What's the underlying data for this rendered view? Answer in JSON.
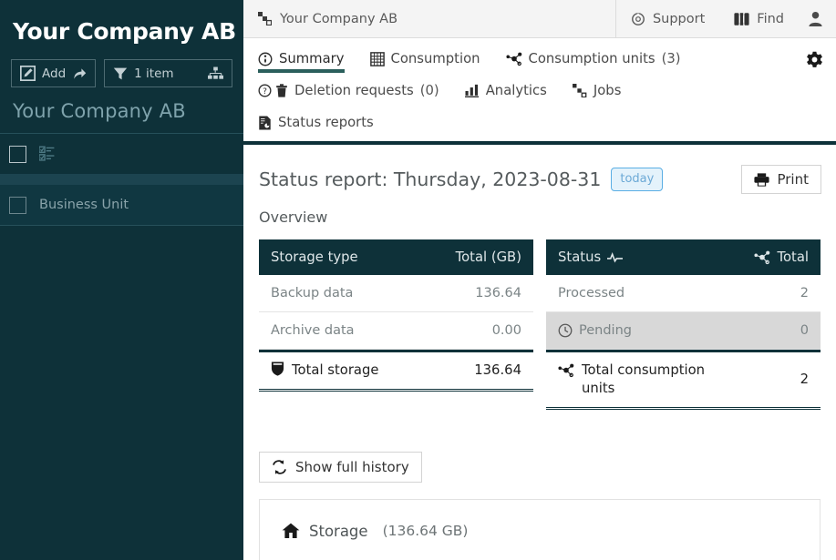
{
  "sidebar": {
    "logo": "Your Company AB",
    "add_label": "Add",
    "filter_label": "1 item",
    "title": "Your Company AB",
    "rows": [
      {
        "label": ""
      },
      {
        "label": "Business Unit"
      }
    ]
  },
  "topbar": {
    "breadcrumb": "Your Company AB",
    "support": "Support",
    "find": "Find"
  },
  "tabs": [
    {
      "label": "Summary",
      "count": "",
      "active": true
    },
    {
      "label": "Consumption",
      "count": "",
      "active": false
    },
    {
      "label": "Consumption units",
      "count": "(3)",
      "active": false
    },
    {
      "label": "Deletion requests",
      "count": "(0)",
      "active": false
    },
    {
      "label": "Analytics",
      "count": "",
      "active": false
    },
    {
      "label": "Jobs",
      "count": "",
      "active": false
    },
    {
      "label": "Status reports",
      "count": "",
      "active": false
    }
  ],
  "report": {
    "title": "Status report: Thursday, 2023-08-31",
    "today_badge": "today",
    "print_label": "Print",
    "overview_label": "Overview",
    "history_label": "Show full history"
  },
  "storage_table": {
    "header_left": "Storage type",
    "header_right": "Total (GB)",
    "rows": [
      {
        "label": "Backup data",
        "value": "136.64"
      },
      {
        "label": "Archive data",
        "value": "0.00"
      }
    ],
    "footer_label": "Total storage",
    "footer_value": "136.64"
  },
  "status_table": {
    "header_left": "Status",
    "header_right": "Total",
    "rows": [
      {
        "label": "Processed",
        "value": "2",
        "highlight": false
      },
      {
        "label": "Pending",
        "value": "0",
        "highlight": true
      }
    ],
    "footer_label": "Total consumption units",
    "footer_value": "2"
  },
  "storage_panel": {
    "title": "Storage",
    "size": "(136.64 GB)"
  },
  "colors": {
    "sidebar_bg": "#0e3139",
    "accent_underline": "#2b5f5c",
    "badge_border": "#5aaee4",
    "badge_bg": "#e4f2fb",
    "highlight_row": "#d8d8d8"
  }
}
